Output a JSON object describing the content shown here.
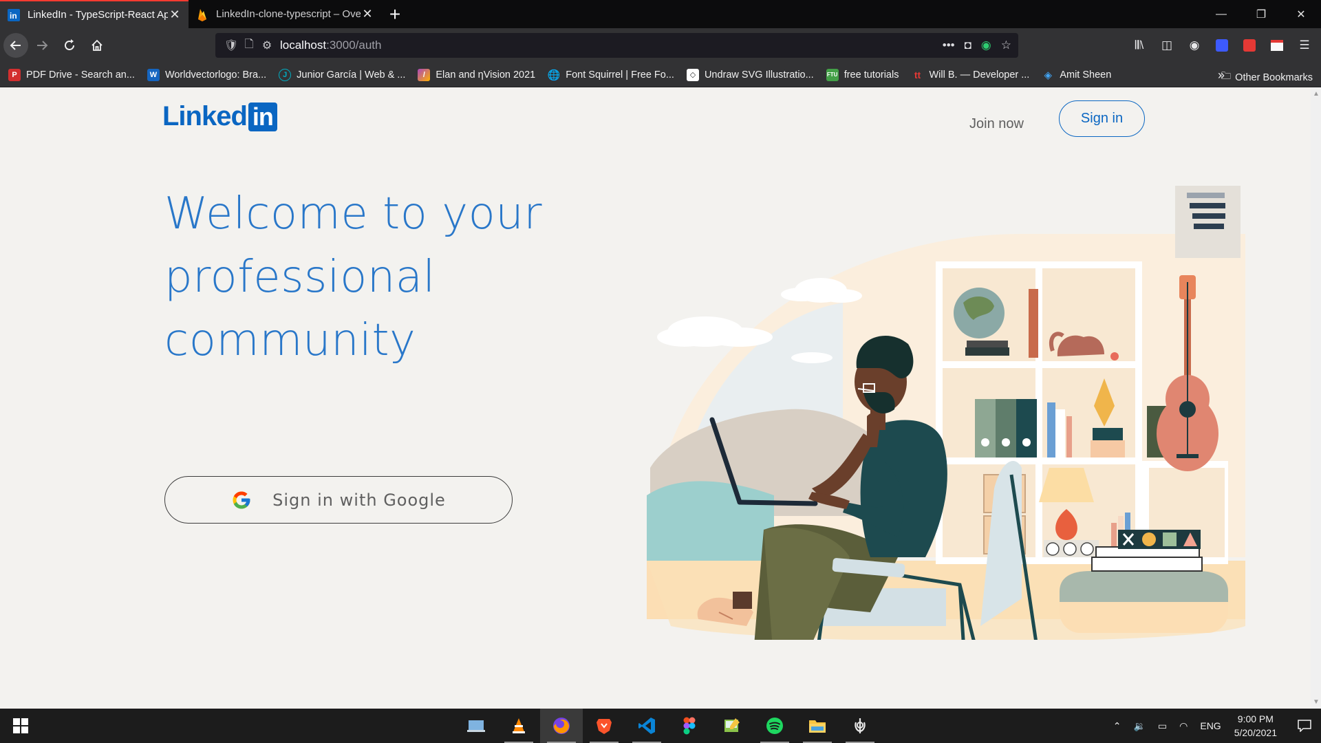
{
  "browser": {
    "tabs": [
      {
        "title": "LinkedIn - TypeScript-React App",
        "favicon": "linkedin-icon",
        "active": true
      },
      {
        "title": "LinkedIn-clone-typescript – Overview",
        "favicon": "firebase-icon",
        "active": false
      }
    ],
    "url": {
      "host": "localhost",
      "path": ":3000/auth"
    },
    "bookmarks": [
      {
        "label": "PDF Drive - Search an...",
        "icon": "pdf-drive-icon",
        "color": "#d32f2f"
      },
      {
        "label": "Worldvectorlogo: Bra...",
        "icon": "worldvectorlogo-icon",
        "color": "#1565c0"
      },
      {
        "label": "Junior García | Web & ...",
        "icon": "junior-garcia-icon",
        "color": "#00acc1"
      },
      {
        "label": "Elan and ηVision 2021",
        "icon": "elan-icon",
        "color": "#ab47bc"
      },
      {
        "label": "Font Squirrel | Free Fo...",
        "icon": "globe-icon",
        "color": "#616161"
      },
      {
        "label": "Undraw SVG Illustratio...",
        "icon": "undraw-icon",
        "color": "#ffffff"
      },
      {
        "label": "free tutorials",
        "icon": "ftu-icon",
        "color": "#43a047"
      },
      {
        "label": "Will B. — Developer ...",
        "icon": "will-b-icon",
        "color": "#e53935"
      },
      {
        "label": "Amit Sheen",
        "icon": "codepen-icon",
        "color": "#42a5f5"
      }
    ],
    "other_bookmarks": "Other Bookmarks"
  },
  "page": {
    "logo_word": "Linked",
    "logo_box": "in",
    "join_now": "Join now",
    "sign_in": "Sign in",
    "headline": "Welcome to your professional community",
    "google_button": "Sign in with Google",
    "brand_color": "#0a66c2",
    "headline_color": "#2977c9"
  },
  "taskbar": {
    "apps": [
      "file-explorer-icon",
      "vlc-icon",
      "firefox-icon",
      "brave-icon",
      "vscode-icon",
      "figma-icon",
      "paint-icon",
      "spotify-icon",
      "folder-icon",
      "khanda-icon"
    ],
    "language": "ENG",
    "time": "9:00 PM",
    "date": "5/20/2021"
  }
}
